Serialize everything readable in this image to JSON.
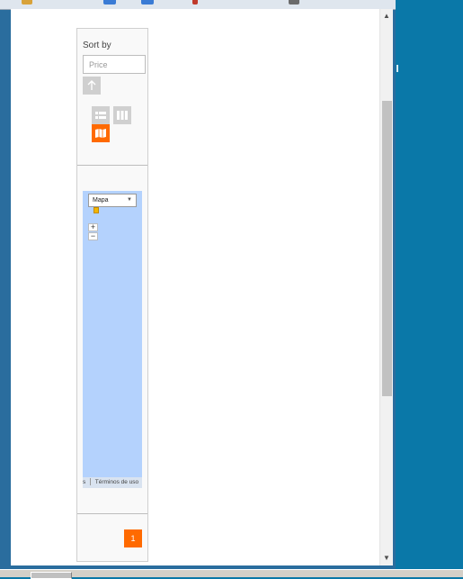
{
  "page": {
    "sort": {
      "label": "Sort by",
      "input_placeholder": "Price",
      "direction_icon": "arrow-up-icon"
    },
    "view_modes": [
      {
        "name": "list-view-icon",
        "active": false
      },
      {
        "name": "grid-view-icon",
        "active": false
      },
      {
        "name": "map-view-icon",
        "active": true
      }
    ],
    "map": {
      "type_select": "Mapa",
      "zoom_in": "+",
      "zoom_out": "−",
      "footer_cut": "s",
      "footer_terms": "Términos de uso"
    },
    "pagination": {
      "current_page": "1"
    }
  },
  "colors": {
    "accent": "#ff6a00",
    "map_water": "#b4d2fd",
    "desktop": "#0a78a8"
  }
}
